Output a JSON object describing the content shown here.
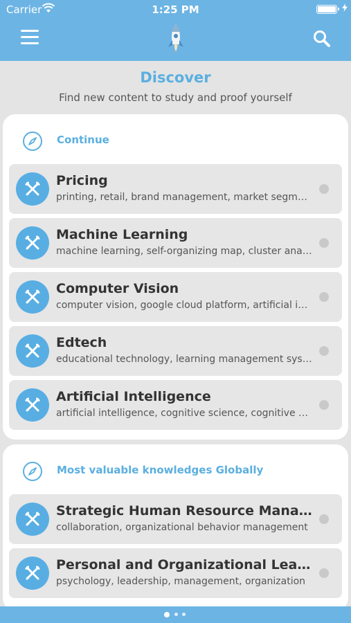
{
  "status": {
    "carrier": "Carrier",
    "time": "1:25 PM",
    "battery_level": 1.0
  },
  "header": {
    "menu_icon": "hamburger-icon",
    "logo_icon": "rocket-icon",
    "search_icon": "search-icon"
  },
  "hero": {
    "title": "Discover",
    "subtitle": "Find new content to study and proof yourself"
  },
  "sections": [
    {
      "title": "Continue",
      "icon": "compass-icon",
      "items": [
        {
          "title": "Pricing",
          "subtitle": "printing, retail, brand management, market segmentation"
        },
        {
          "title": "Machine Learning",
          "subtitle": "machine learning, self-organizing map, cluster analysis"
        },
        {
          "title": "Computer Vision",
          "subtitle": "computer vision, google cloud platform, artificial intelligence"
        },
        {
          "title": "Edtech",
          "subtitle": "educational technology, learning management system"
        },
        {
          "title": "Artificial Intelligence",
          "subtitle": "artificial intelligence, cognitive science, cognitive computing"
        }
      ]
    },
    {
      "title": "Most valuable knowledges Globally",
      "icon": "compass-icon",
      "items": [
        {
          "title": "Strategic Human Resource Management",
          "subtitle": "collaboration, organizational behavior management"
        },
        {
          "title": "Personal and Organizational Leadership",
          "subtitle": "psychology, leadership, management, organization"
        }
      ]
    }
  ],
  "pager": {
    "pages": 3,
    "active": 0
  },
  "colors": {
    "accent": "#6cb4e4",
    "title": "#5aafe0",
    "item_bg": "#e6e6e6"
  }
}
